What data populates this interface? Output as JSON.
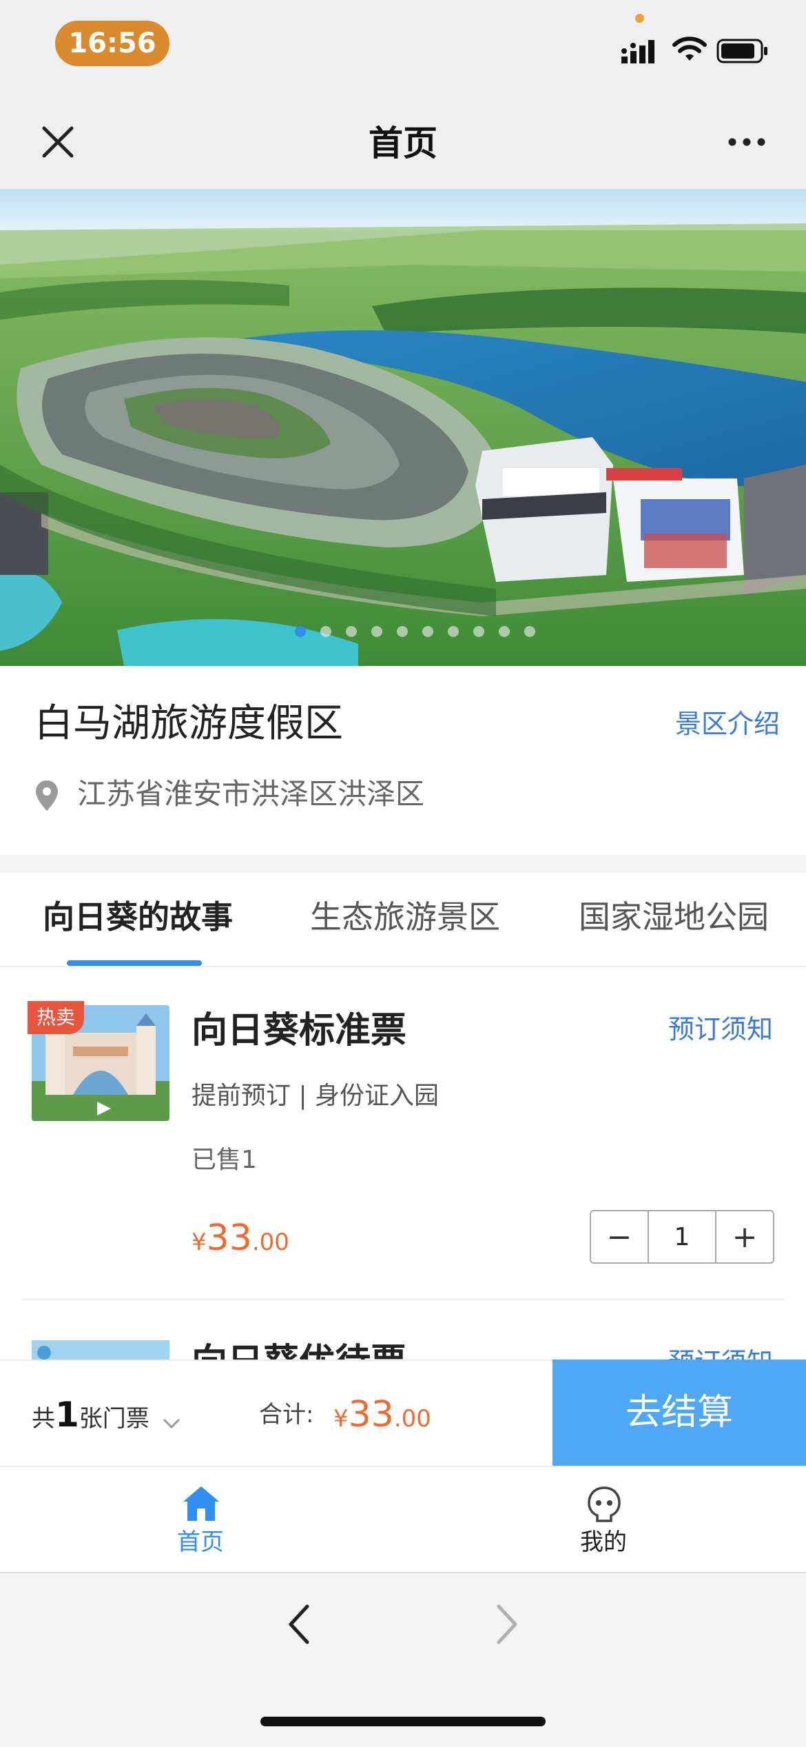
{
  "status_bar": {
    "time": "16:56"
  },
  "nav": {
    "title": "首页"
  },
  "hero": {
    "slide_count": 10,
    "active_slide": 1
  },
  "scenic": {
    "name": "白马湖旅游度假区",
    "intro_link": "景区介绍",
    "address": "江苏省淮安市洪泽区洪泽区"
  },
  "tabs": [
    {
      "label": "向日葵的故事",
      "active": true
    },
    {
      "label": "生态旅游景区",
      "active": false
    },
    {
      "label": "国家湿地公园",
      "active": false
    }
  ],
  "ticket": {
    "badge": "热卖",
    "name": "向日葵标准票",
    "notice_link": "预订须知",
    "tags": "提前预订 | 身份证入园",
    "sold": "已售1",
    "currency": "¥",
    "price_int": "33",
    "price_dec": ".00",
    "quantity": "1",
    "minus": "−",
    "plus": "+"
  },
  "ticket2": {
    "name": "向日葵优待票",
    "notice_link": "预订须知"
  },
  "cart": {
    "count_prefix": "共",
    "count": "1",
    "count_suffix": "张门票",
    "sum_label": "合计:",
    "currency": "¥",
    "price_int": "33",
    "price_dec": ".00",
    "checkout": "去结算"
  },
  "tabbar": {
    "home": "首页",
    "mine": "我的"
  },
  "colors": {
    "accent": "#2f8ef0",
    "price": "#ee6a2e",
    "checkout_bg": "#4fa8f5",
    "link": "#3a7bd5"
  }
}
